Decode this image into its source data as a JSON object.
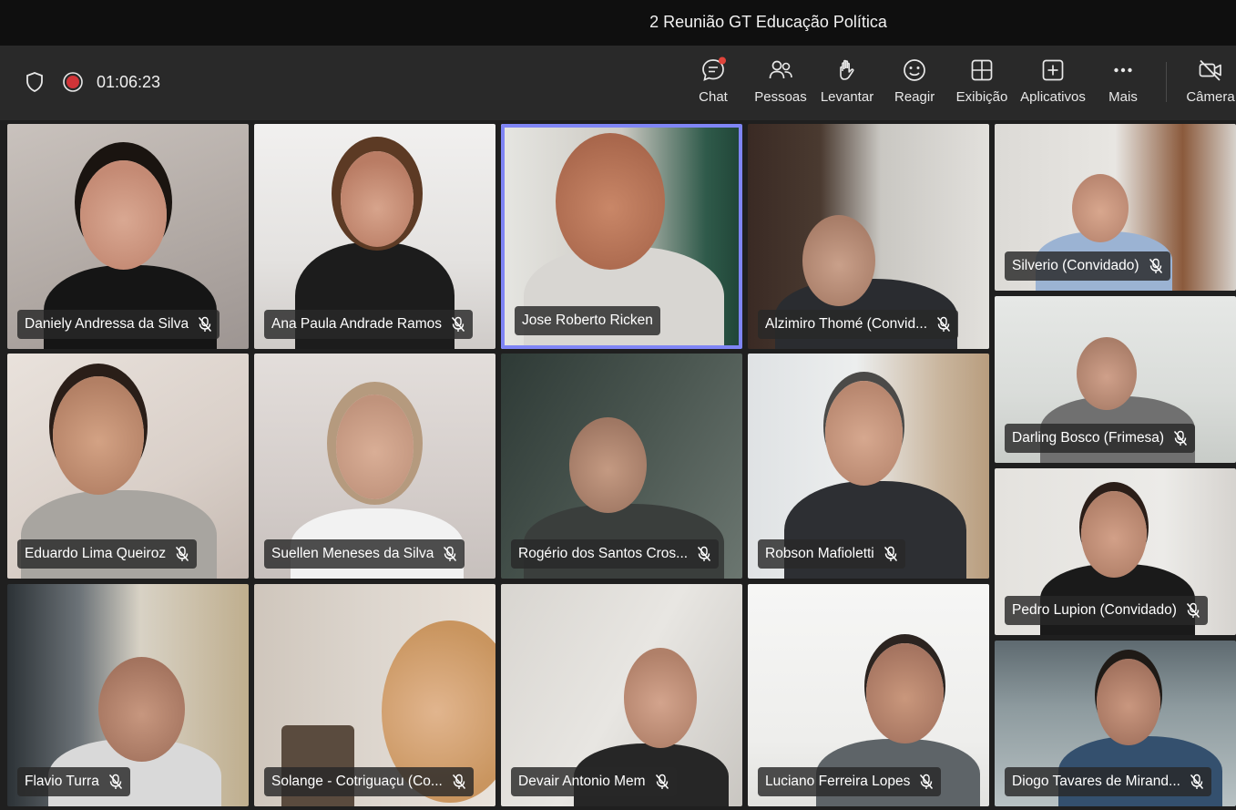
{
  "meeting": {
    "title": "2 Reunião GT Educação Política",
    "elapsed": "01:06:23"
  },
  "toolbar": {
    "chat": "Chat",
    "people": "Pessoas",
    "raise": "Levantar",
    "react": "Reagir",
    "view": "Exibição",
    "apps": "Aplicativos",
    "more": "Mais",
    "camera": "Câmera"
  },
  "participants": [
    "Daniely Andressa da Silva",
    "Ana Paula Andrade Ramos",
    "Jose Roberto Ricken",
    "Alzimiro Thomé (Convid...",
    "Silverio (Convidado)",
    "Eduardo Lima Queiroz",
    "Suellen Meneses da Silva",
    "Rogério dos Santos Cros...",
    "Robson Mafioletti",
    "Darling Bosco (Frimesa)",
    "Flavio Turra",
    "Solange - Cotriguaçu (Co...",
    "Devair Antonio Mem",
    "Luciano Ferreira Lopes",
    "Pedro Lupion (Convidado)",
    "Diogo Tavares de Mirand..."
  ],
  "colors": {
    "accent": "#7f85f5",
    "recording": "#d13438",
    "chat_badge": "#e0443b"
  }
}
